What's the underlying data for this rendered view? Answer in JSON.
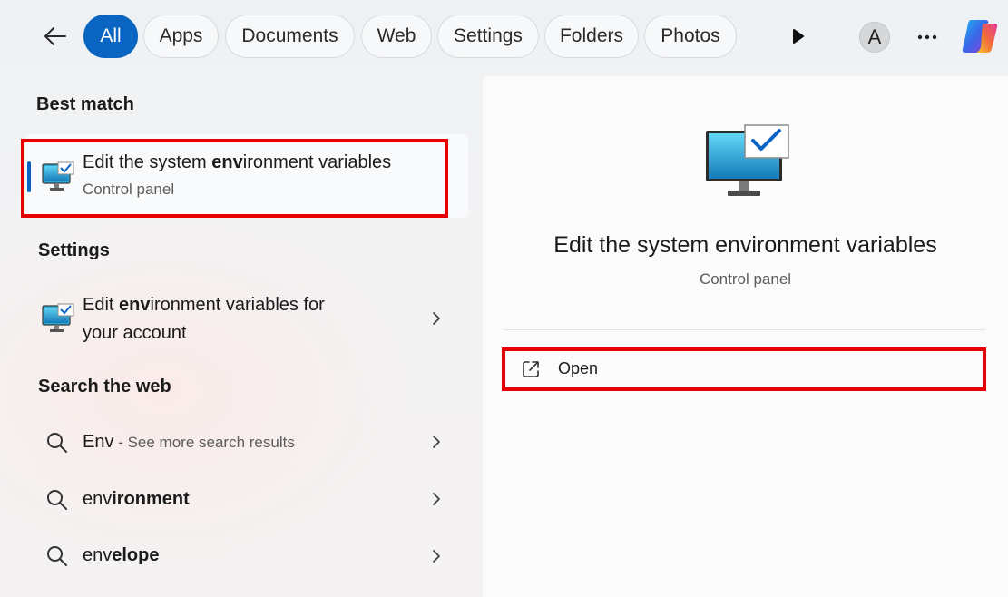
{
  "filters": {
    "tabs": [
      {
        "label": "All",
        "active": true
      },
      {
        "label": "Apps"
      },
      {
        "label": "Documents"
      },
      {
        "label": "Web"
      },
      {
        "label": "Settings"
      },
      {
        "label": "Folders"
      },
      {
        "label": "Photos"
      }
    ],
    "avatar_letter": "A",
    "icons": [
      "back-arrow-icon",
      "play-icon",
      "more-icon",
      "copilot-icon"
    ]
  },
  "left": {
    "best_match": {
      "header": "Best match",
      "title_pre": "Edit the system ",
      "title_bold": "env",
      "title_post": "ironment variables",
      "subtitle": "Control panel"
    },
    "settings": {
      "header": "Settings",
      "line1_pre": "Edit ",
      "line1_bold": "env",
      "line1_post": "ironment variables for",
      "line2": "your account"
    },
    "web": {
      "header": "Search the web",
      "items": [
        {
          "query": "Env",
          "suffix": " - See more search results"
        },
        {
          "query_plain": "env",
          "query_bold": "ironment"
        },
        {
          "query_plain": "env",
          "query_bold": "elope"
        }
      ]
    }
  },
  "right": {
    "title": "Edit the system environment variables",
    "subtitle": "Control panel",
    "action_open": "Open"
  },
  "colors": {
    "accent": "#0a64c2",
    "highlight": "#e60000"
  }
}
